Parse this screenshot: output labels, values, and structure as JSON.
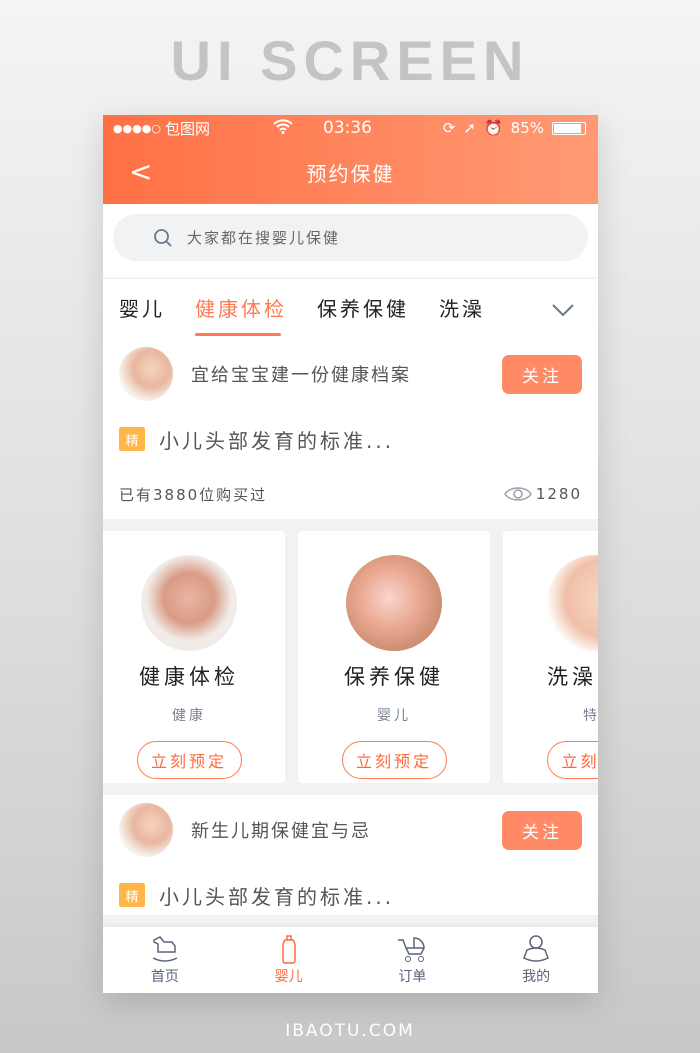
{
  "hero": "UI SCREEN",
  "footer": "IBAOTU.COM",
  "status": {
    "carrier": "包图网",
    "signal": "●●●●○",
    "time": "03:36",
    "battery": "85%",
    "battery_level": 0.85
  },
  "nav": {
    "title": "预约保健",
    "back": "<"
  },
  "search": {
    "placeholder": "大家都在搜婴儿保健"
  },
  "tabs": [
    {
      "label": "婴儿"
    },
    {
      "label": "健康体检",
      "active": true
    },
    {
      "label": "保养保健"
    },
    {
      "label": "洗澡"
    }
  ],
  "accent": "#ff7a50",
  "posts": [
    {
      "title": "宜给宝宝建一份健康档案",
      "follow": "关注",
      "tag": "精",
      "text": "小儿头部发育的标准...",
      "bought": "已有3880位购买过",
      "views": "1280"
    },
    {
      "title": "新生儿期保健宜与忌",
      "follow": "关注",
      "tag": "精",
      "text": "小儿头部发育的标准..."
    }
  ],
  "cards": [
    {
      "name": "健康体检",
      "sub": "健康",
      "button": "立刻预定"
    },
    {
      "name": "保养保健",
      "sub": "婴儿",
      "button": "立刻预定"
    },
    {
      "name": "洗澡",
      "sub": "特",
      "button": "立刻预定"
    }
  ],
  "tabbar": [
    {
      "label": "首页",
      "icon": "rocking-horse-icon"
    },
    {
      "label": "婴儿",
      "icon": "baby-bottle-icon",
      "active": true
    },
    {
      "label": "订单",
      "icon": "stroller-icon"
    },
    {
      "label": "我的",
      "icon": "baby-icon"
    }
  ]
}
